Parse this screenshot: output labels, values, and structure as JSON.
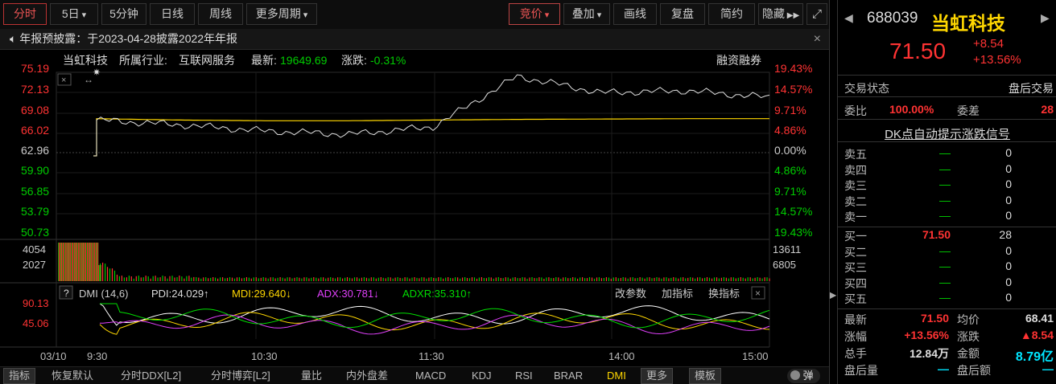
{
  "toolbar": {
    "left_tabs": [
      "分时",
      "5日",
      "5分钟",
      "日线",
      "周线",
      "更多周期"
    ],
    "right_buttons": [
      "竞价",
      "叠加",
      "画线",
      "复盘",
      "简约",
      "隐藏"
    ],
    "arrow_icon": "double-right-arrow",
    "fullscreen_icon": "fullscreen-icon"
  },
  "notice": {
    "text": "年报预披露：于2023-04-28披露2022年年报",
    "close": "×"
  },
  "chart_header": {
    "name": "当虹科技",
    "industry_label": "所属行业:",
    "industry": "互联网服务",
    "latest_label": "最新:",
    "latest": "19649.69",
    "change_label": "涨跌:",
    "change": "-0.31%",
    "margin": "融资融券"
  },
  "price_axis": {
    "left": [
      "75.19",
      "72.13",
      "69.08",
      "66.02",
      "62.96",
      "59.90",
      "56.85",
      "53.79",
      "50.73"
    ],
    "right": [
      "19.43%",
      "14.57%",
      "9.71%",
      "4.86%",
      "0.00%",
      "4.86%",
      "9.71%",
      "14.57%",
      "19.43%"
    ]
  },
  "volume_axis": {
    "left": [
      "4054",
      "2027"
    ],
    "right": [
      "13611",
      "6805"
    ]
  },
  "dmi": {
    "help": "?",
    "name": "DMI (14,6)",
    "pdi": "PDI:24.029↑",
    "mdi": "MDI:29.640↓",
    "adx": "ADX:30.781↓",
    "adxr": "ADXR:35.310↑",
    "actions": [
      "改参数",
      "加指标",
      "换指标"
    ],
    "close": "×",
    "axis": [
      "90.13",
      "45.06"
    ]
  },
  "time_axis": {
    "date": "03/10",
    "ticks": [
      "9:30",
      "10:30",
      "11:30",
      "14:00",
      "15:00"
    ]
  },
  "bottom_tabs": [
    "指标",
    "恢复默认",
    "分时DDX[L2]",
    "分时博弈[L2]",
    "量比",
    "内外盘差",
    "MACD",
    "KDJ",
    "RSI",
    "BRAR",
    "DMI",
    "更多",
    "模板",
    "弹"
  ],
  "chart_data": {
    "type": "line",
    "x": [
      "9:30",
      "10:00",
      "10:30",
      "11:00",
      "11:30",
      "13:30",
      "14:00",
      "14:30",
      "15:00"
    ],
    "y_range": [
      50.73,
      75.19
    ],
    "base_price": 62.96,
    "series": [
      {
        "values": [
          68.2,
          67.5,
          66.6,
          66.1,
          67.2,
          74.6,
          72.2,
          72.5,
          71.5
        ]
      },
      {
        "values": [
          68.4,
          68.2,
          68.1,
          68.1,
          68.2,
          68.3,
          68.35,
          68.4,
          68.41
        ]
      }
    ]
  },
  "quote": {
    "code": "688039",
    "name": "当虹科技",
    "price": "71.50",
    "change": "+8.54",
    "change_pct": "+13.56%",
    "status_label": "交易状态",
    "status": "盘后交易",
    "wb_label": "委比",
    "wb": "100.00%",
    "wc_label": "委差",
    "wc": "28",
    "dk": "DK点自动提示涨跌信号",
    "sell": [
      {
        "label": "卖五",
        "price": "—",
        "vol": "0"
      },
      {
        "label": "卖四",
        "price": "—",
        "vol": "0"
      },
      {
        "label": "卖三",
        "price": "—",
        "vol": "0"
      },
      {
        "label": "卖二",
        "price": "—",
        "vol": "0"
      },
      {
        "label": "卖一",
        "price": "—",
        "vol": "0"
      }
    ],
    "buy": [
      {
        "label": "买一",
        "price": "71.50",
        "vol": "28"
      },
      {
        "label": "买二",
        "price": "—",
        "vol": "0"
      },
      {
        "label": "买三",
        "price": "—",
        "vol": "0"
      },
      {
        "label": "买四",
        "price": "—",
        "vol": "0"
      },
      {
        "label": "买五",
        "price": "—",
        "vol": "0"
      }
    ],
    "stats": [
      {
        "l1": "最新",
        "v1": "71.50",
        "l2": "均价",
        "v2": "68.41"
      },
      {
        "l1": "涨幅",
        "v1": "+13.56%",
        "l2": "涨跌",
        "v2": "▲8.54"
      },
      {
        "l1": "总手",
        "v1": "12.84万",
        "l2": "金额",
        "v2": "8.79亿"
      },
      {
        "l1": "盘后量",
        "v1": "—",
        "l2": "盘后额",
        "v2": "—"
      }
    ]
  },
  "colors": {
    "up": "#ff3333",
    "down": "#00cc00",
    "avg": "#ffd700",
    "price": "#e0e0e0"
  }
}
